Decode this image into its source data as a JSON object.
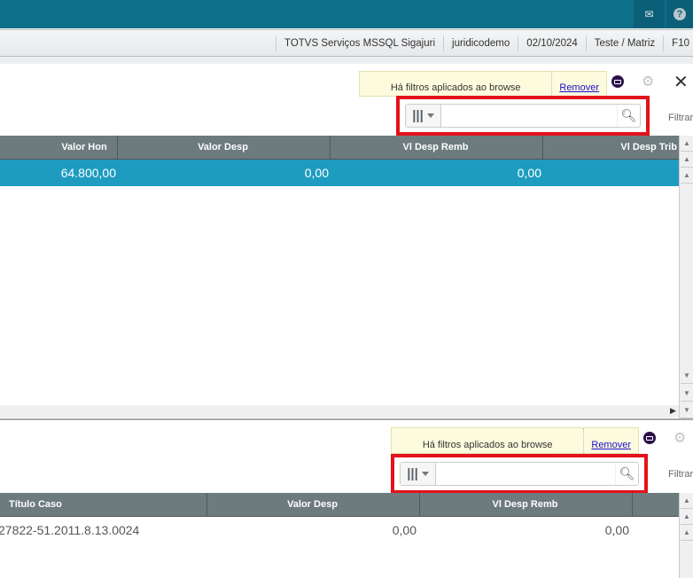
{
  "header": {
    "mail_icon": "envelope-icon",
    "help_icon": "question-circle-icon"
  },
  "statusbar": [
    "TOTVS Serviços MSSQL Sigajuri",
    "juridicodemo",
    "02/10/2024",
    "Teste / Matriz",
    "F10"
  ],
  "panel1": {
    "notice": "Há filtros aplicados ao browse",
    "remove": "Remover",
    "filter_label": "Filtrar",
    "search_value": "",
    "search_placeholder": "",
    "columns": [
      "Valor Hon",
      "Valor Desp",
      "Vl Desp Remb",
      "Vl Desp Trib"
    ],
    "rows": [
      [
        "64.800,00",
        "0,00",
        "0,00",
        ""
      ]
    ],
    "selected_color": "#1e9cc0"
  },
  "panel2": {
    "notice": "Há filtros aplicados ao browse",
    "remove": "Remover",
    "filter_label": "Filtrar",
    "search_value": "",
    "search_placeholder": "",
    "columns": [
      "Título Caso",
      "Valor Desp",
      "Vl Desp Remb"
    ],
    "rows": [
      [
        "27822-51.2011.8.13.0024",
        "0,00",
        "0,00"
      ]
    ]
  },
  "highlight_color": "#e3121b"
}
